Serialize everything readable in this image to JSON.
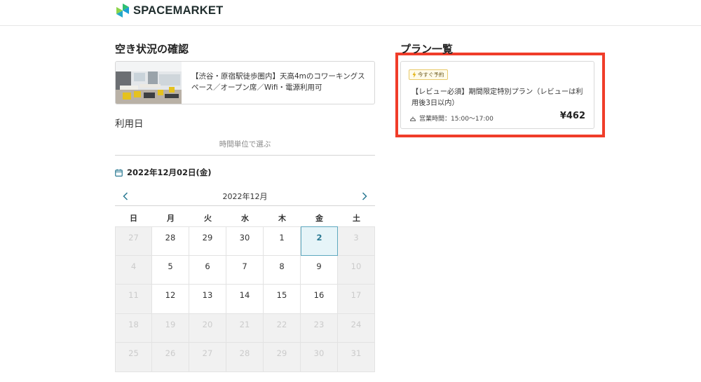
{
  "brand": {
    "name": "SPACEMARKET"
  },
  "availability": {
    "title": "空き状況の確認",
    "space_name": "【渋谷・原宿駅徒歩圏内】天高4mのコワーキングスペース／オープン席／Wifi・電源利用可",
    "date_label": "利用日",
    "mode_tab": "時間単位で選ぶ",
    "selected_date": "2022年12月02日(金)"
  },
  "calendar": {
    "month_title": "2022年12月",
    "weekdays": [
      "日",
      "月",
      "火",
      "水",
      "木",
      "金",
      "土"
    ],
    "days": [
      {
        "label": "27",
        "state": "disabled"
      },
      {
        "label": "28",
        "state": "enabled"
      },
      {
        "label": "29",
        "state": "enabled"
      },
      {
        "label": "30",
        "state": "enabled"
      },
      {
        "label": "1",
        "state": "enabled"
      },
      {
        "label": "2",
        "state": "selected"
      },
      {
        "label": "3",
        "state": "disabled"
      },
      {
        "label": "4",
        "state": "disabled"
      },
      {
        "label": "5",
        "state": "enabled"
      },
      {
        "label": "6",
        "state": "enabled"
      },
      {
        "label": "7",
        "state": "enabled"
      },
      {
        "label": "8",
        "state": "enabled"
      },
      {
        "label": "9",
        "state": "enabled"
      },
      {
        "label": "10",
        "state": "disabled"
      },
      {
        "label": "11",
        "state": "disabled"
      },
      {
        "label": "12",
        "state": "enabled"
      },
      {
        "label": "13",
        "state": "enabled"
      },
      {
        "label": "14",
        "state": "enabled"
      },
      {
        "label": "15",
        "state": "enabled"
      },
      {
        "label": "16",
        "state": "enabled"
      },
      {
        "label": "17",
        "state": "disabled"
      },
      {
        "label": "18",
        "state": "disabled"
      },
      {
        "label": "19",
        "state": "disabled"
      },
      {
        "label": "20",
        "state": "disabled"
      },
      {
        "label": "21",
        "state": "disabled"
      },
      {
        "label": "22",
        "state": "disabled"
      },
      {
        "label": "23",
        "state": "disabled"
      },
      {
        "label": "24",
        "state": "disabled"
      },
      {
        "label": "25",
        "state": "disabled"
      },
      {
        "label": "26",
        "state": "disabled"
      },
      {
        "label": "27",
        "state": "disabled"
      },
      {
        "label": "28",
        "state": "disabled"
      },
      {
        "label": "29",
        "state": "disabled"
      },
      {
        "label": "30",
        "state": "disabled"
      },
      {
        "label": "31",
        "state": "disabled"
      }
    ]
  },
  "plans": {
    "title": "プラン一覧",
    "items": [
      {
        "badge": "今すぐ予約",
        "name": "【レビュー必須】期間限定特別プラン（レビューは利用後3日以内）",
        "hours": "営業時間：15:00〜17:00",
        "price": "¥462"
      }
    ]
  },
  "colors": {
    "highlight": "#f03d2a",
    "selected_day": "#2b7a93",
    "accent_arrow": "#2b7a93",
    "badge_border": "#e8c96a"
  },
  "icons": [
    "spacemarket-logo-icon",
    "calendar-icon",
    "chevron-left-icon",
    "chevron-right-icon",
    "lightning-icon",
    "clock-icon"
  ]
}
